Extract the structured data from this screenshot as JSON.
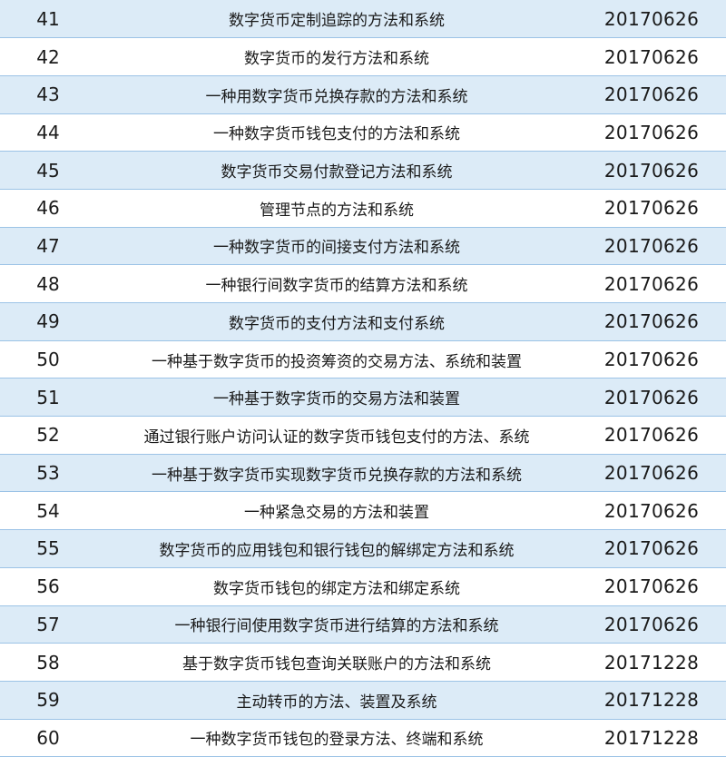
{
  "table": {
    "rows": [
      {
        "num": "41",
        "title": "数字货币定制追踪的方法和系统",
        "date": "20170626"
      },
      {
        "num": "42",
        "title": "数字货币的发行方法和系统",
        "date": "20170626"
      },
      {
        "num": "43",
        "title": "一种用数字货币兑换存款的方法和系统",
        "date": "20170626"
      },
      {
        "num": "44",
        "title": "一种数字货币钱包支付的方法和系统",
        "date": "20170626"
      },
      {
        "num": "45",
        "title": "数字货币交易付款登记方法和系统",
        "date": "20170626"
      },
      {
        "num": "46",
        "title": "管理节点的方法和系统",
        "date": "20170626"
      },
      {
        "num": "47",
        "title": "一种数字货币的间接支付方法和系统",
        "date": "20170626"
      },
      {
        "num": "48",
        "title": "一种银行间数字货币的结算方法和系统",
        "date": "20170626"
      },
      {
        "num": "49",
        "title": "数字货币的支付方法和支付系统",
        "date": "20170626"
      },
      {
        "num": "50",
        "title": "一种基于数字货币的投资筹资的交易方法、系统和装置",
        "date": "20170626"
      },
      {
        "num": "51",
        "title": "一种基于数字货币的交易方法和装置",
        "date": "20170626"
      },
      {
        "num": "52",
        "title": "通过银行账户访问认证的数字货币钱包支付的方法、系统",
        "date": "20170626"
      },
      {
        "num": "53",
        "title": "一种基于数字货币实现数字货币兑换存款的方法和系统",
        "date": "20170626"
      },
      {
        "num": "54",
        "title": "一种紧急交易的方法和装置",
        "date": "20170626"
      },
      {
        "num": "55",
        "title": "数字货币的应用钱包和银行钱包的解绑定方法和系统",
        "date": "20170626"
      },
      {
        "num": "56",
        "title": "数字货币钱包的绑定方法和绑定系统",
        "date": "20170626"
      },
      {
        "num": "57",
        "title": "一种银行间使用数字货币进行结算的方法和系统",
        "date": "20170626"
      },
      {
        "num": "58",
        "title": "基于数字货币钱包查询关联账户的方法和系统",
        "date": "20171228"
      },
      {
        "num": "59",
        "title": "主动转币的方法、装置及系统",
        "date": "20171228"
      },
      {
        "num": "60",
        "title": "一种数字货币钱包的登录方法、终端和系统",
        "date": "20171228"
      }
    ]
  },
  "colors": {
    "shaded_row": "#dcebf7",
    "plain_row": "#ffffff",
    "row_border": "#9cc3e6"
  }
}
